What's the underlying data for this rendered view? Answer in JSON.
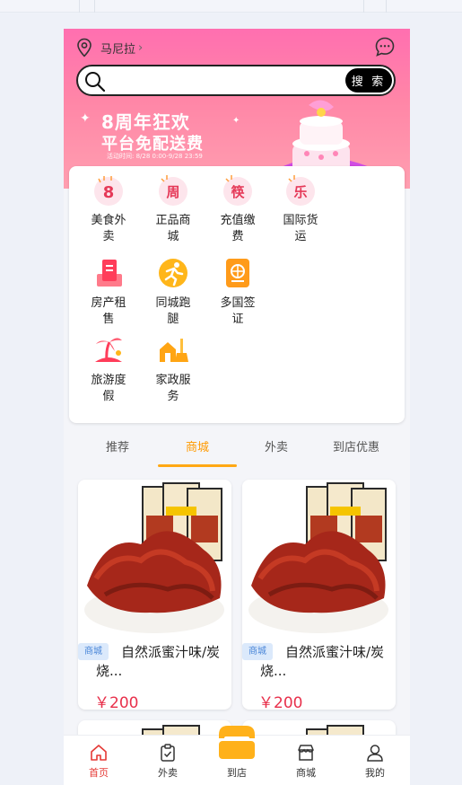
{
  "header": {
    "location": "马尼拉",
    "search_placeholder": "",
    "search_button": "搜 索",
    "banner_title": "8周年狂欢",
    "banner_subtitle": "平台免配送费",
    "banner_time": "活动时间: 8/28 0:00-9/28 23:59"
  },
  "categories": [
    {
      "label": "美食外卖",
      "icon": "food-delivery-icon"
    },
    {
      "label": "正品商城",
      "icon": "mall-icon"
    },
    {
      "label": "充值缴费",
      "icon": "recharge-icon"
    },
    {
      "label": "国际货运",
      "icon": "freight-icon"
    },
    {
      "label": "房产租售",
      "icon": "real-estate-icon"
    },
    {
      "label": "同城跑腿",
      "icon": "errand-icon"
    },
    {
      "label": "多国签证",
      "icon": "visa-icon"
    },
    {
      "label": "旅游度假",
      "icon": "travel-icon"
    },
    {
      "label": "家政服务",
      "icon": "housekeeping-icon"
    }
  ],
  "tabs": [
    {
      "label": "推荐"
    },
    {
      "label": "商城",
      "active": true
    },
    {
      "label": "外卖"
    },
    {
      "label": "到店优惠"
    }
  ],
  "products": [
    {
      "tag": "商城",
      "title": "自然派蜜汁味/炭烧...",
      "price": "￥200"
    },
    {
      "tag": "商城",
      "title": "自然派蜜汁味/炭烧...",
      "price": "￥200"
    }
  ],
  "nav": [
    {
      "label": "首页",
      "icon": "home-icon",
      "active": true
    },
    {
      "label": "外卖",
      "icon": "clipboard-icon"
    },
    {
      "label": "到店",
      "icon": "store-center-icon"
    },
    {
      "label": "商城",
      "icon": "shop-icon"
    },
    {
      "label": "我的",
      "icon": "user-icon"
    }
  ],
  "colors": {
    "header_gradient_top": "#ff6fb0",
    "header_gradient_bottom": "#ff9fb0",
    "tab_active": "#ff9a00",
    "price": "#e8304b",
    "nav_active": "#e53935",
    "tag_bg": "#dbe9fb"
  }
}
